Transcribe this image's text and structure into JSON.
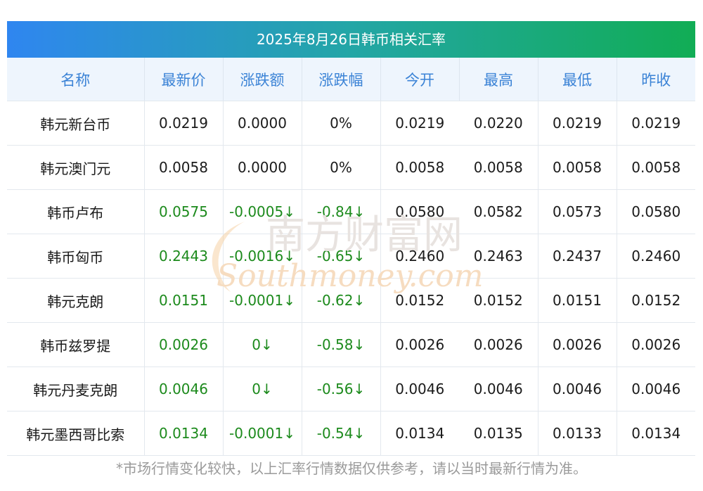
{
  "title": "2025年8月26日韩币相关汇率",
  "columns": [
    "名称",
    "最新价",
    "涨跌额",
    "涨跌幅",
    "今开",
    "最高",
    "最低",
    "昨收"
  ],
  "rows": [
    {
      "name": "韩元新台币",
      "latest": "0.0219",
      "change": "0.0000",
      "change_pct": "0%",
      "open": "0.0219",
      "high": "0.0220",
      "low": "0.0219",
      "prev_close": "0.0219",
      "direction": "flat"
    },
    {
      "name": "韩元澳门元",
      "latest": "0.0058",
      "change": "0.0000",
      "change_pct": "0%",
      "open": "0.0058",
      "high": "0.0058",
      "low": "0.0058",
      "prev_close": "0.0058",
      "direction": "flat"
    },
    {
      "name": "韩币卢布",
      "latest": "0.0575",
      "change": "-0.0005↓",
      "change_pct": "-0.84↓",
      "open": "0.0580",
      "high": "0.0582",
      "low": "0.0573",
      "prev_close": "0.0580",
      "direction": "down"
    },
    {
      "name": "韩币匈币",
      "latest": "0.2443",
      "change": "-0.0016↓",
      "change_pct": "-0.65↓",
      "open": "0.2460",
      "high": "0.2463",
      "low": "0.2437",
      "prev_close": "0.2460",
      "direction": "down"
    },
    {
      "name": "韩元克朗",
      "latest": "0.0151",
      "change": "-0.0001↓",
      "change_pct": "-0.62↓",
      "open": "0.0152",
      "high": "0.0152",
      "low": "0.0151",
      "prev_close": "0.0152",
      "direction": "down"
    },
    {
      "name": "韩币兹罗提",
      "latest": "0.0026",
      "change": "0↓",
      "change_pct": "-0.58↓",
      "open": "0.0026",
      "high": "0.0026",
      "low": "0.0026",
      "prev_close": "0.0026",
      "direction": "down"
    },
    {
      "name": "韩元丹麦克朗",
      "latest": "0.0046",
      "change": "0↓",
      "change_pct": "-0.56↓",
      "open": "0.0046",
      "high": "0.0046",
      "low": "0.0046",
      "prev_close": "0.0046",
      "direction": "down"
    },
    {
      "name": "韩元墨西哥比索",
      "latest": "0.0134",
      "change": "-0.0001↓",
      "change_pct": "-0.54↓",
      "open": "0.0134",
      "high": "0.0135",
      "low": "0.0133",
      "prev_close": "0.0134",
      "direction": "down"
    }
  ],
  "watermark": {
    "cn": "南方财富网",
    "en": "Southmoney.com"
  },
  "footnote": "*市场行情变化较快，以上汇率行情数据仅供参考，请以当时最新行情为准。",
  "colors": {
    "header_text": "#3b83d6",
    "down": "#1c8a1c",
    "gradient_start": "#2f86f0",
    "gradient_end": "#11ad55"
  }
}
